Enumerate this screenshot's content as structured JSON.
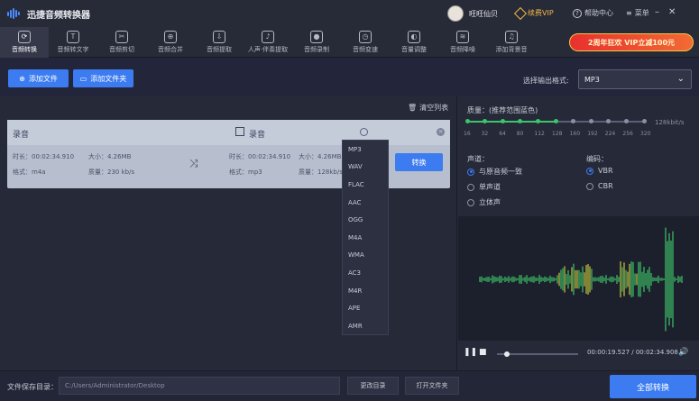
{
  "app": {
    "title": "迅捷音频转换器",
    "user_name": "旺旺仙贝",
    "vip_label": "续费VIP",
    "help_label": "帮助中心",
    "menu_label": "菜单"
  },
  "toolbar": {
    "items": [
      "音频转换",
      "音频转文字",
      "音频剪切",
      "音频合并",
      "音频提取",
      "人声·伴奏提取",
      "音频录制",
      "音频变速",
      "音量调整",
      "音频降噪",
      "添加背景音"
    ],
    "active": 0,
    "icons": [
      "convert-icon",
      "speech-to-text-icon",
      "scissors-icon",
      "merge-icon",
      "extract-icon",
      "vocal-icon",
      "record-icon",
      "speed-icon",
      "volume-icon",
      "noise-icon",
      "bgm-icon"
    ]
  },
  "promo": {
    "label": "2周年狂欢 VIP立减100元"
  },
  "actions": {
    "add_file": "添加文件",
    "add_folder": "添加文件夹",
    "clear_list": "清空列表"
  },
  "output_format": {
    "label": "选择输出格式:",
    "value": "MP3"
  },
  "file": {
    "source": {
      "name": "录音",
      "duration_label": "时长：",
      "duration": "00:02:34.910",
      "size_label": "大小：",
      "size": "4.26MB",
      "format_label": "格式：",
      "format": "m4a",
      "quality_label": "质量：",
      "quality": "230 kb/s"
    },
    "target": {
      "name": "录音",
      "duration_label": "时长：",
      "duration": "00:02:34.910",
      "size_label": "大小：",
      "size": "4.26MB",
      "format_label": "格式：",
      "format": "mp3",
      "quality_label": "质量：",
      "quality": "128kb/s"
    },
    "convert_label": "转换"
  },
  "format_options": [
    "MP3",
    "WAV",
    "FLAC",
    "AAC",
    "OGG",
    "M4A",
    "WMA",
    "AC3",
    "M4R",
    "APE",
    "AMR"
  ],
  "quality": {
    "label": "质量：(推荐范围蓝色)",
    "ticks": [
      "16",
      "32",
      "64",
      "80",
      "112",
      "128",
      "160",
      "192",
      "224",
      "256",
      "320"
    ],
    "selected_index": 5,
    "unit": "128kbit/s"
  },
  "channel": {
    "label": "声道：",
    "options": [
      "与原音频一致",
      "单声道",
      "立体声"
    ],
    "selected": 0
  },
  "encoding": {
    "label": "编码：",
    "options": [
      "VBR",
      "CBR"
    ],
    "selected": 0
  },
  "player": {
    "play_icon": "pause-icon",
    "stop_icon": "stop-icon",
    "time": "00:00:19.527 / 00:02:34.908",
    "progress": 0.13
  },
  "bottom": {
    "save_label": "文件保存目录：",
    "path": "C:/Users/Administrator/Desktop",
    "change_dir": "更改目录",
    "open_folder": "打开文件夹",
    "convert_all": "全部转换"
  },
  "colors": {
    "accent": "#3c7cf0",
    "wave_green": "#3ec46a",
    "wave_yellow": "#c9c43a",
    "promo_red": "#e8302e"
  }
}
